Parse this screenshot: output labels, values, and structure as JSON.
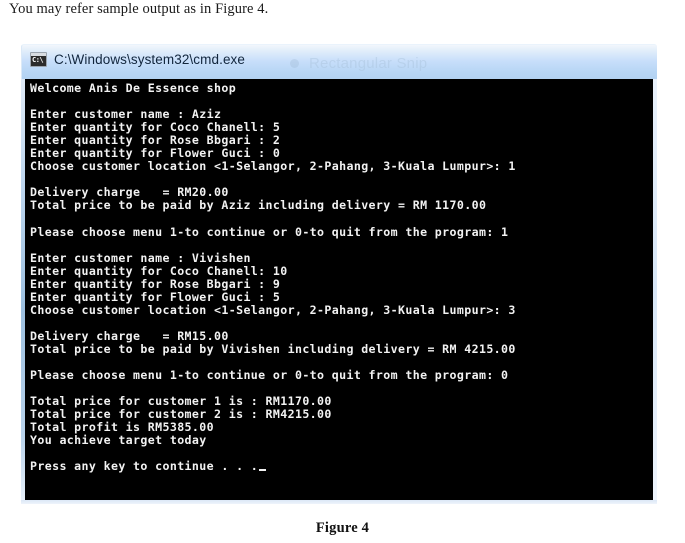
{
  "document": {
    "intro_text": "You may refer sample output as in Figure 4.",
    "figure_caption": "Figure 4"
  },
  "window": {
    "title": "C:\\Windows\\system32\\cmd.exe",
    "icon_name": "cmd-exe-icon",
    "icon_glyph": "C:\\",
    "watermark": "Rectangular Snip",
    "colors": {
      "titlebar_top": "#f2f7fc",
      "titlebar_bottom": "#b2d2f2",
      "console_background": "#000000",
      "console_foreground": "#f2f2f2",
      "frame_border": "#bdd6ef"
    }
  },
  "console": {
    "lines": [
      "Welcome Anis De Essence shop",
      "",
      "Enter customer name : Aziz",
      "Enter quantity for Coco Chanell: 5",
      "Enter quantity for Rose Bbgari : 2",
      "Enter quantity for Flower Guci : 0",
      "Choose customer location <1-Selangor, 2-Pahang, 3-Kuala Lumpur>: 1",
      "",
      "Delivery charge   = RM20.00",
      "Total price to be paid by Aziz including delivery = RM 1170.00",
      "",
      "Please choose menu 1-to continue or 0-to quit from the program: 1",
      "",
      "Enter customer name : Vivishen",
      "Enter quantity for Coco Chanell: 10",
      "Enter quantity for Rose Bbgari : 9",
      "Enter quantity for Flower Guci : 5",
      "Choose customer location <1-Selangor, 2-Pahang, 3-Kuala Lumpur>: 3",
      "",
      "Delivery charge   = RM15.00",
      "Total price to be paid by Vivishen including delivery = RM 4215.00",
      "",
      "Please choose menu 1-to continue or 0-to quit from the program: 0",
      "",
      "Total price for customer 1 is : RM1170.00",
      "Total price for customer 2 is : RM4215.00",
      "Total profit is RM5385.00",
      "You achieve target today",
      "",
      "Press any key to continue . . ."
    ],
    "cursor_after_last_line": true
  }
}
